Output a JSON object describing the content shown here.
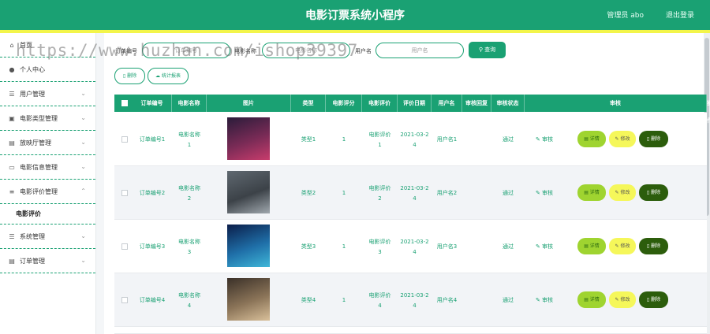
{
  "header": {
    "title": "电影订票系统小程序",
    "admin": "管理员 abo",
    "logout": "退出登录"
  },
  "watermark": "https://www.huzhan.com/ishop39397",
  "sidebar": {
    "items": [
      {
        "label": "首页",
        "icon": "home-icon",
        "glyph": "⌂"
      },
      {
        "label": "个人中心",
        "icon": "user-icon",
        "glyph": "●"
      },
      {
        "label": "用户管理",
        "icon": "list-icon",
        "glyph": "☰"
      },
      {
        "label": "电影类型管理",
        "icon": "briefcase-icon",
        "glyph": "▣"
      },
      {
        "label": "放映厅管理",
        "icon": "doc-icon",
        "glyph": "▤"
      },
      {
        "label": "电影信息管理",
        "icon": "monitor-icon",
        "glyph": "▭"
      },
      {
        "label": "电影评价管理",
        "icon": "sliders-icon",
        "glyph": "≡"
      },
      {
        "label": "系统管理",
        "icon": "list-icon",
        "glyph": "☰"
      },
      {
        "label": "订单管理",
        "icon": "cart-icon",
        "glyph": "▤"
      }
    ],
    "subitem": "电影评价"
  },
  "search": {
    "order_label": "订单编号",
    "order_placeholder": "订单编号",
    "movie_label": "电影名称",
    "movie_placeholder": "电影名称",
    "user_label": "用户名",
    "user_placeholder": "用户名",
    "button": "查询"
  },
  "ops": {
    "delete": "删除",
    "report": "统计报表"
  },
  "table": {
    "headers": [
      "订单编号",
      "电影名称",
      "图片",
      "类型",
      "电影评分",
      "电影评价",
      "评价日期",
      "用户名",
      "审核回复",
      "审核状态",
      "审核",
      "操作"
    ],
    "rows": [
      {
        "order": "订单编号1",
        "movie_a": "电影名称",
        "movie_b": "1",
        "type": "类型1",
        "score": "1",
        "review_a": "电影评价",
        "review_b": "1",
        "date_a": "2021-03-2",
        "date_b": "4",
        "user": "用户名1",
        "reply": "",
        "status": "通过",
        "audit": "审核"
      },
      {
        "order": "订单编号2",
        "movie_a": "电影名称",
        "movie_b": "2",
        "type": "类型2",
        "score": "1",
        "review_a": "电影评价",
        "review_b": "2",
        "date_a": "2021-03-2",
        "date_b": "4",
        "user": "用户名2",
        "reply": "",
        "status": "通过",
        "audit": "审核"
      },
      {
        "order": "订单编号3",
        "movie_a": "电影名称",
        "movie_b": "3",
        "type": "类型3",
        "score": "1",
        "review_a": "电影评价",
        "review_b": "3",
        "date_a": "2021-03-2",
        "date_b": "4",
        "user": "用户名3",
        "reply": "",
        "status": "通过",
        "audit": "审核"
      },
      {
        "order": "订单编号4",
        "movie_a": "电影名称",
        "movie_b": "4",
        "type": "类型4",
        "score": "1",
        "review_a": "电影评价",
        "review_b": "4",
        "date_a": "2021-03-2",
        "date_b": "4",
        "user": "用户名4",
        "reply": "",
        "status": "通过",
        "audit": "审核"
      }
    ],
    "btn_detail": "详情",
    "btn_edit": "修改",
    "btn_delete": "删除"
  },
  "colors": {
    "primary": "#1aa173",
    "accent_line": "#f3f54a",
    "detail": "#9fd430",
    "edit": "#f5f75a",
    "delete": "#2c5d0c"
  }
}
